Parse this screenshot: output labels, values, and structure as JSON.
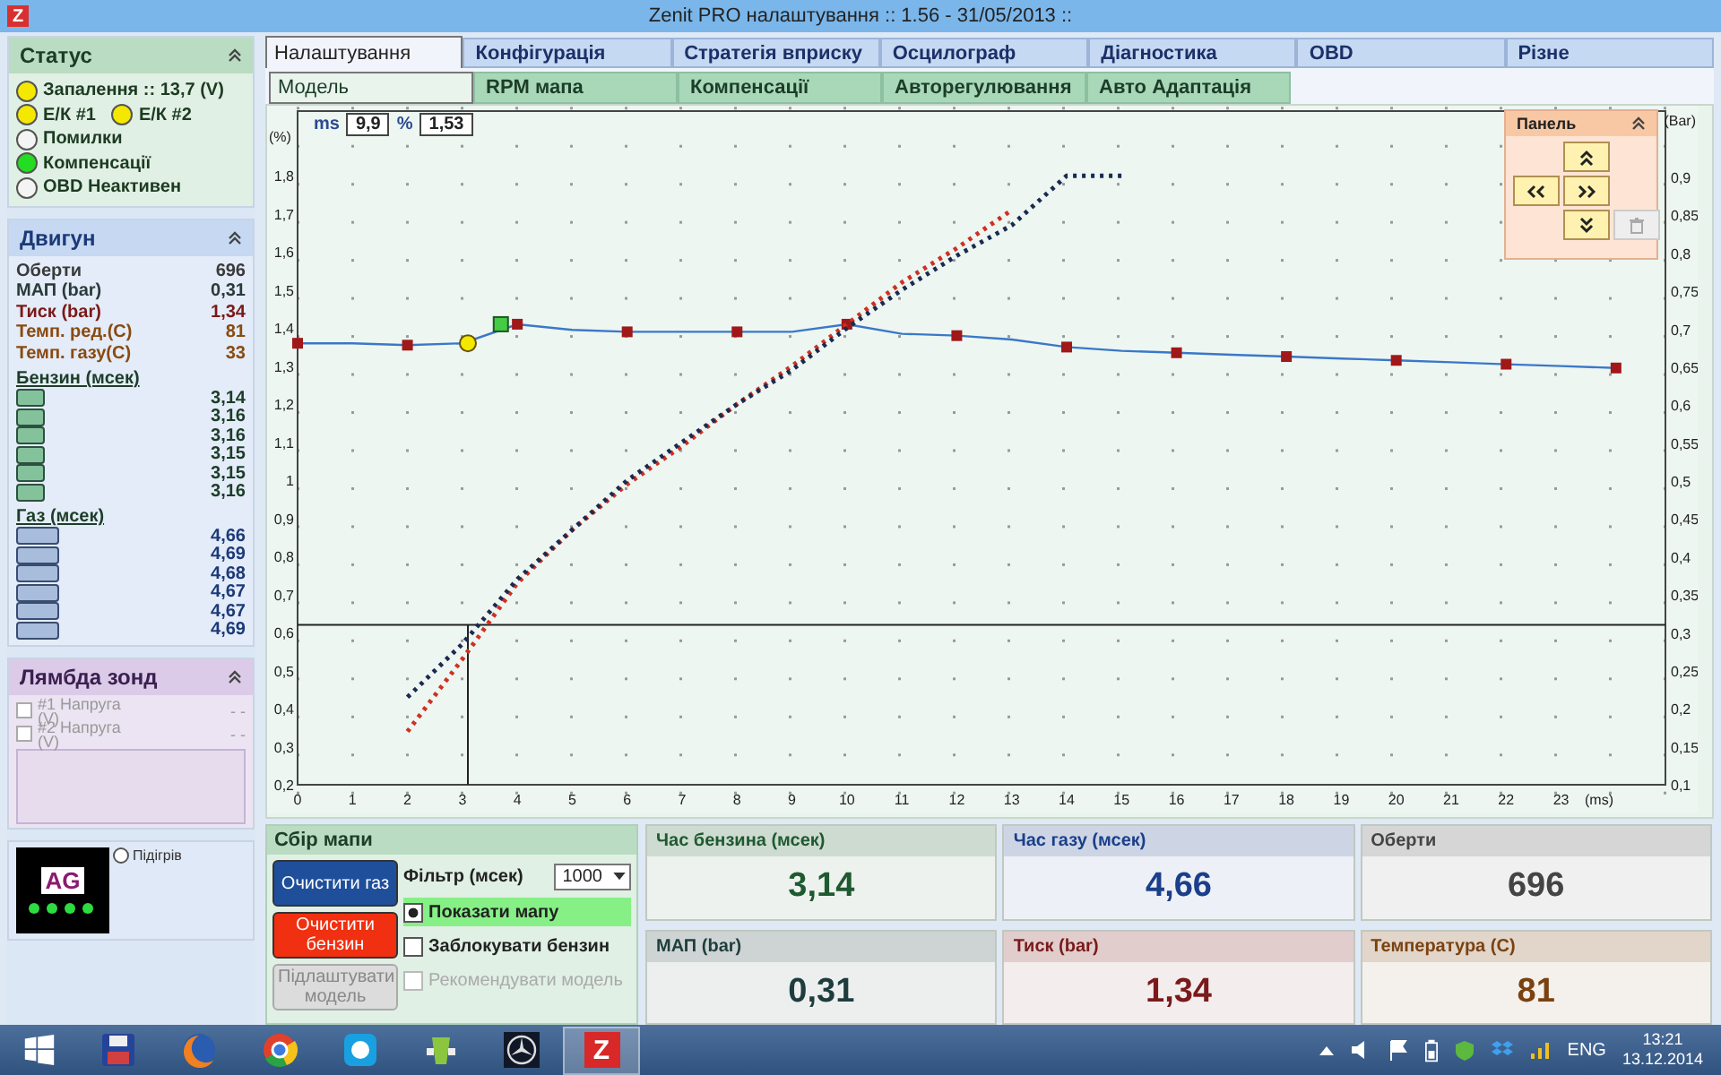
{
  "window": {
    "title": "Zenit PRO налаштування :: 1.56 - 31/05/2013 ::",
    "icon_letter": "Z"
  },
  "status": {
    "title": "Статус",
    "rows": [
      [
        {
          "label": "Запалення :: 13,7 (V)",
          "color": "#f5e800"
        }
      ],
      [
        {
          "label": "Е/К #1",
          "color": "#f5e800"
        },
        {
          "label": "Е/К #2",
          "color": "#f5e800"
        }
      ],
      [
        {
          "label": "Помилки",
          "color": "#f4f4f4"
        }
      ],
      [
        {
          "label": "Компенсації",
          "color": "#22dd22"
        }
      ],
      [
        {
          "label": "OBD Неактивен",
          "color": "#f4f4f4"
        }
      ]
    ]
  },
  "engine": {
    "title": "Двигун",
    "params": [
      {
        "label": "Оберти",
        "value": "696",
        "color": "#3a3a3a"
      },
      {
        "label": "МАП (bar)",
        "value": "0,31",
        "color": "#2a3a3a"
      },
      {
        "label": "Тиск (bar)",
        "value": "1,34",
        "color": "#7a1818"
      },
      {
        "label": "Темп. ред.(С)",
        "value": "81",
        "color": "#8a4a10"
      },
      {
        "label": "Темп. газу(С)",
        "value": "33",
        "color": "#8a4a10"
      }
    ],
    "petrol": {
      "title": "Бензин (мсек)",
      "values": [
        "3,14",
        "3,16",
        "3,16",
        "3,15",
        "3,15",
        "3,16"
      ]
    },
    "gas": {
      "title": "Газ (мсек)",
      "values": [
        "4,66",
        "4,69",
        "4,68",
        "4,67",
        "4,67",
        "4,69"
      ]
    }
  },
  "lambda": {
    "title": "Лямбда зонд",
    "sensors": [
      {
        "label": "#1 Напруга (V)",
        "value": "- -",
        "checked": false
      },
      {
        "label": "#2 Напруга (V)",
        "value": "- -",
        "checked": false
      }
    ]
  },
  "indicator": {
    "logo": "AG",
    "warmup": {
      "label": "Підігрів",
      "on": false
    }
  },
  "tabs": [
    {
      "label": "Налаштування",
      "selected": true
    },
    {
      "label": "Конфігурація",
      "selected": false
    },
    {
      "label": "Стратегія вприску",
      "selected": false
    },
    {
      "label": "Осцилограф",
      "selected": false
    },
    {
      "label": "Діагностика",
      "selected": false
    },
    {
      "label": "OBD",
      "selected": false
    },
    {
      "label": "Різне",
      "selected": false
    }
  ],
  "subtabs": [
    {
      "label": "Модель",
      "selected": true
    },
    {
      "label": "RPM мапа",
      "selected": false
    },
    {
      "label": "Компенсації",
      "selected": false
    },
    {
      "label": "Авторегулювання",
      "selected": false
    },
    {
      "label": "Авто Адаптація",
      "selected": false
    }
  ],
  "chart": {
    "readout": {
      "ms_label": "ms",
      "ms": "9,9",
      "percent_label": "%",
      "percent": "1,53"
    },
    "right_axis": {
      "label": "(Bar)",
      "ticks": [
        "0,9",
        "0,85",
        "0,8",
        "0,75",
        "0,7",
        "0,65",
        "0,6",
        "0,55",
        "0,5",
        "0,45",
        "0,4",
        "0,35",
        "0,3",
        "0,25",
        "0,2",
        "0,15",
        "0,1"
      ]
    },
    "chart_data": {
      "type": "line",
      "xlabel": "(ms)",
      "ylabel": "(%)",
      "xlim": [
        0,
        24.9
      ],
      "ylim": [
        0.2,
        1.97
      ],
      "x": [
        0,
        1,
        2,
        3,
        4,
        5,
        6,
        7,
        8,
        9,
        10,
        11,
        12,
        13,
        14,
        15,
        16,
        17,
        18,
        19,
        20,
        21,
        22,
        23,
        24
      ],
      "xticks": [
        0,
        1,
        2,
        3,
        4,
        5,
        6,
        7,
        8,
        9,
        10,
        11,
        12,
        13,
        14,
        15,
        16,
        17,
        18,
        19,
        20,
        21,
        22,
        23
      ],
      "yticks": [
        {
          "value": 0.2,
          "label": "0,2"
        },
        {
          "value": 0.3,
          "label": "0,3"
        },
        {
          "value": 0.4,
          "label": "0,4"
        },
        {
          "value": 0.5,
          "label": "0,5"
        },
        {
          "value": 0.6,
          "label": "0,6"
        },
        {
          "value": 0.7,
          "label": "0,7"
        },
        {
          "value": 0.8,
          "label": "0,8"
        },
        {
          "value": 0.9,
          "label": "0,9"
        },
        {
          "value": 1.0,
          "label": "1"
        },
        {
          "value": 1.1,
          "label": "1,1"
        },
        {
          "value": 1.2,
          "label": "1,2"
        },
        {
          "value": 1.3,
          "label": "1,3"
        },
        {
          "value": 1.4,
          "label": "1,4"
        },
        {
          "value": 1.5,
          "label": "1,5"
        },
        {
          "value": 1.6,
          "label": "1,6"
        },
        {
          "value": 1.7,
          "label": "1,7"
        },
        {
          "value": 1.8,
          "label": "1,8"
        }
      ],
      "series": [
        {
          "line_style": "solid",
          "color": "#3a78c8",
          "values": [
            1.36,
            1.36,
            1.355,
            1.36,
            1.41,
            1.395,
            1.39,
            1.39,
            1.39,
            1.39,
            1.41,
            1.385,
            1.38,
            1.37,
            1.35,
            1.34,
            1.335,
            1.33,
            1.325,
            1.32,
            1.315,
            1.31,
            1.305,
            1.3,
            1.295
          ]
        },
        {
          "line_style": "dotted",
          "color": "#d03020",
          "values": [
            null,
            null,
            0.34,
            0.53,
            0.73,
            0.87,
            0.99,
            1.09,
            1.2,
            1.3,
            1.41,
            1.52,
            1.61,
            1.71,
            null,
            null,
            null,
            null,
            null,
            null,
            null,
            null,
            null,
            null,
            null
          ]
        },
        {
          "line_style": "dotted",
          "color": "#1a2a50",
          "values": [
            null,
            null,
            0.43,
            0.57,
            0.74,
            0.87,
            1.0,
            1.1,
            1.2,
            1.29,
            1.4,
            1.5,
            1.59,
            1.67,
            1.8,
            1.8,
            null,
            null,
            null,
            null,
            null,
            null,
            null,
            null,
            null
          ]
        }
      ],
      "ref_lines": [
        {
          "axis": "y",
          "value": 0.62
        },
        {
          "axis": "x",
          "value": 3.1
        }
      ]
    }
  },
  "panel": {
    "title": "Панель",
    "buttons": [
      {
        "kind": "up",
        "disabled": false
      },
      {
        "kind": "left",
        "disabled": false
      },
      {
        "kind": "right",
        "disabled": false
      },
      {
        "kind": "down",
        "disabled": false
      },
      {
        "kind": "delete",
        "disabled": true
      }
    ]
  },
  "map_collect": {
    "title": "Сбір мапи",
    "buttons": [
      {
        "label": "Очистити газ",
        "color": "#1f4f9a",
        "disabled": false
      },
      {
        "label": "Очистити бензин",
        "color": "#f03010",
        "disabled": false
      },
      {
        "label": "Підлаштувати модель",
        "color": "#dcdcdc",
        "disabled": true
      }
    ],
    "filter": {
      "label": "Фільтр (мсек)",
      "value": "1000"
    },
    "options": [
      {
        "label": "Показати мапу",
        "checked": true,
        "disabled": false
      },
      {
        "label": "Заблокувати бензин",
        "checked": false,
        "disabled": false
      },
      {
        "label": "Рекомендувати модель",
        "checked": false,
        "disabled": true
      }
    ]
  },
  "tiles": [
    {
      "label": "Час бензина (мсек)",
      "value": "3,14",
      "color": "#1e5a30"
    },
    {
      "label": "Час газу (мсек)",
      "value": "4,66",
      "color": "#1b3f8a"
    },
    {
      "label": "Оберти",
      "value": "696",
      "color": "#444444"
    },
    {
      "label": "МАП (bar)",
      "value": "0,31",
      "color": "#1f3d3d"
    },
    {
      "label": "Тиск (bar)",
      "value": "1,34",
      "color": "#7a1a1a"
    },
    {
      "label": "Температура (С)",
      "value": "81",
      "color": "#7a4210"
    }
  ],
  "taskbar": {
    "apps": [
      {
        "kind": "floppy",
        "selected": false
      },
      {
        "kind": "globe",
        "selected": false
      },
      {
        "kind": "wheel",
        "selected": false
      },
      {
        "kind": "cloud",
        "selected": false
      },
      {
        "kind": "glass",
        "selected": false
      },
      {
        "kind": "star",
        "selected": false
      },
      {
        "kind": "letter",
        "label": "Z",
        "selected": true
      }
    ],
    "tray": {
      "language": "ENG",
      "time": "13:21",
      "date": "13.12.2014"
    }
  }
}
